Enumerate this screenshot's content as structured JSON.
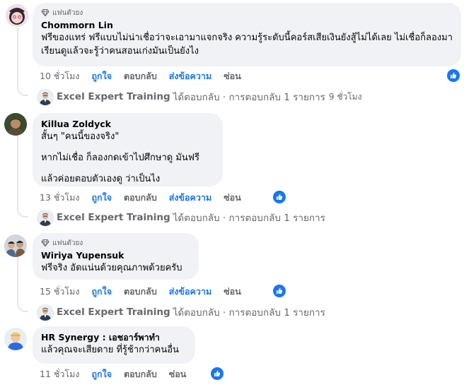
{
  "colors": {
    "accent": "#1877f2",
    "bubble": "#f0f2f5",
    "meta_text": "#65676b"
  },
  "comments": [
    {
      "badge": "แฟนตัวยง",
      "author": "Chommorn Lin",
      "lines": [
        "ฟรีของแทร่ ฟรีแบบไม่น่าเชื่อว่าจะเอามาแจกจริง ความรู้ระดับนี้คอร์สเสียเงินยังสู้ไม่ได้เลย ไม่เชื่อก็ลองมาเรียนดูแล้วจะรู้ว่าคนสอนเก่งมันเป็นยังไง"
      ],
      "time": "10 ชั่วโมง",
      "like": "ถูกใจ",
      "reply": "ตอบกลับ",
      "report": "ส่งข้อความ",
      "hide": "ซ่อน",
      "reply_summary": {
        "page_name": "Excel Expert Training",
        "text": "ได้ตอบกลับ · การตอบกลับ 1 รายการ",
        "ago": "9 ชั่วโมง"
      }
    },
    {
      "author": "Killua Zoldyck",
      "paragraphs": [
        "สั้นๆ \"คนนี้ของจริง\"",
        "หากไม่เชื่อ ก็ลองกดเข้าไปศึกษาดู มันฟรี",
        "แล้วค่อยตอบตัวเองดู ว่าเป็นไง"
      ],
      "time": "13 ชั่วโมง",
      "like": "ถูกใจ",
      "reply": "ตอบกลับ",
      "report": "ส่งข้อความ",
      "hide": "ซ่อน",
      "reply_summary": {
        "page_name": "Excel Expert Training",
        "text": "ได้ตอบกลับ · การตอบกลับ 1 รายการ"
      }
    },
    {
      "badge": "แฟนตัวยง",
      "author": "Wiriya Yupensuk",
      "text": "ฟรีจริง อัดแน่นด้วยคุณภาพด้วยครับ",
      "time": "15 ชั่วโมง",
      "like": "ถูกใจ",
      "reply": "ตอบกลับ",
      "report": "ส่งข้อความ",
      "hide": "ซ่อน",
      "reply_summary": {
        "page_name": "Excel Expert Training",
        "text": "ได้ตอบกลับ · การตอบกลับ 1 รายการ"
      }
    },
    {
      "author": "HR Synergy : เอชอาร์พาทำ",
      "text": "แล้วคุณจะเสียดาย ที่รู้ช้ากว่าคนอื่น",
      "time": "11 ชั่วโมง",
      "like": "ถูกใจ",
      "reply": "ตอบกลับ",
      "hide": "ซ่อน"
    }
  ]
}
